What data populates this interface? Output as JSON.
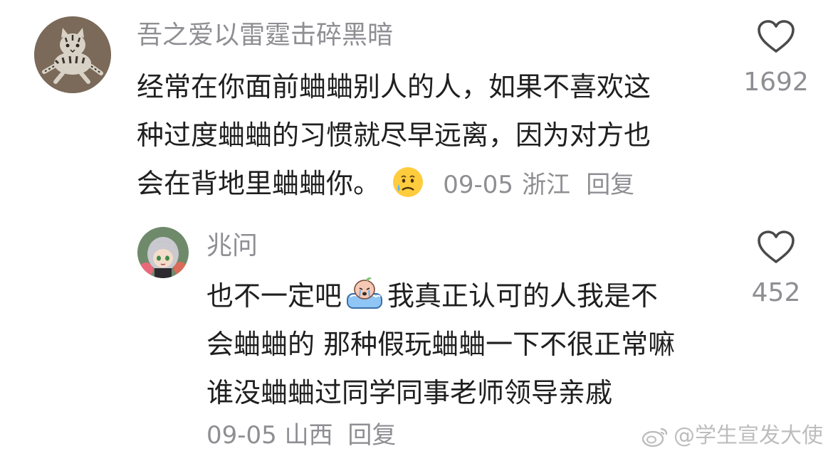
{
  "comments": [
    {
      "username": "吾之爱以雷霆击碎黑暗",
      "text_lines": [
        "经常在你面前蛐蛐别人的人，如果不喜欢这",
        "种过度蛐蛐的习惯就尽早远离，因为对方也",
        "会在背地里蛐蛐你。"
      ],
      "emoji": "crying-face-emoji",
      "date": "09-05",
      "location": "浙江",
      "reply_label": "回复",
      "likes": "1692",
      "avatar": "tabby-cat-avatar"
    },
    {
      "username": "兆问",
      "text_lines": [
        "也不一定吧",
        "我真正认可的人我是不",
        "会蛐蛐的 那种假玩蛐蛐一下不很正常嘛",
        "谁没蛐蛐过同学同事老师领导亲戚"
      ],
      "emoji": "bathtub-crying-emoji",
      "date": "09-05",
      "location": "山西",
      "reply_label": "回复",
      "likes": "452",
      "avatar": "anime-girl-avatar"
    }
  ],
  "watermark": "@学生宣发大使",
  "colors": {
    "primary_text": "#1f1f1f",
    "secondary_text": "#8e8e93",
    "watermark": "#bdbdbd"
  }
}
